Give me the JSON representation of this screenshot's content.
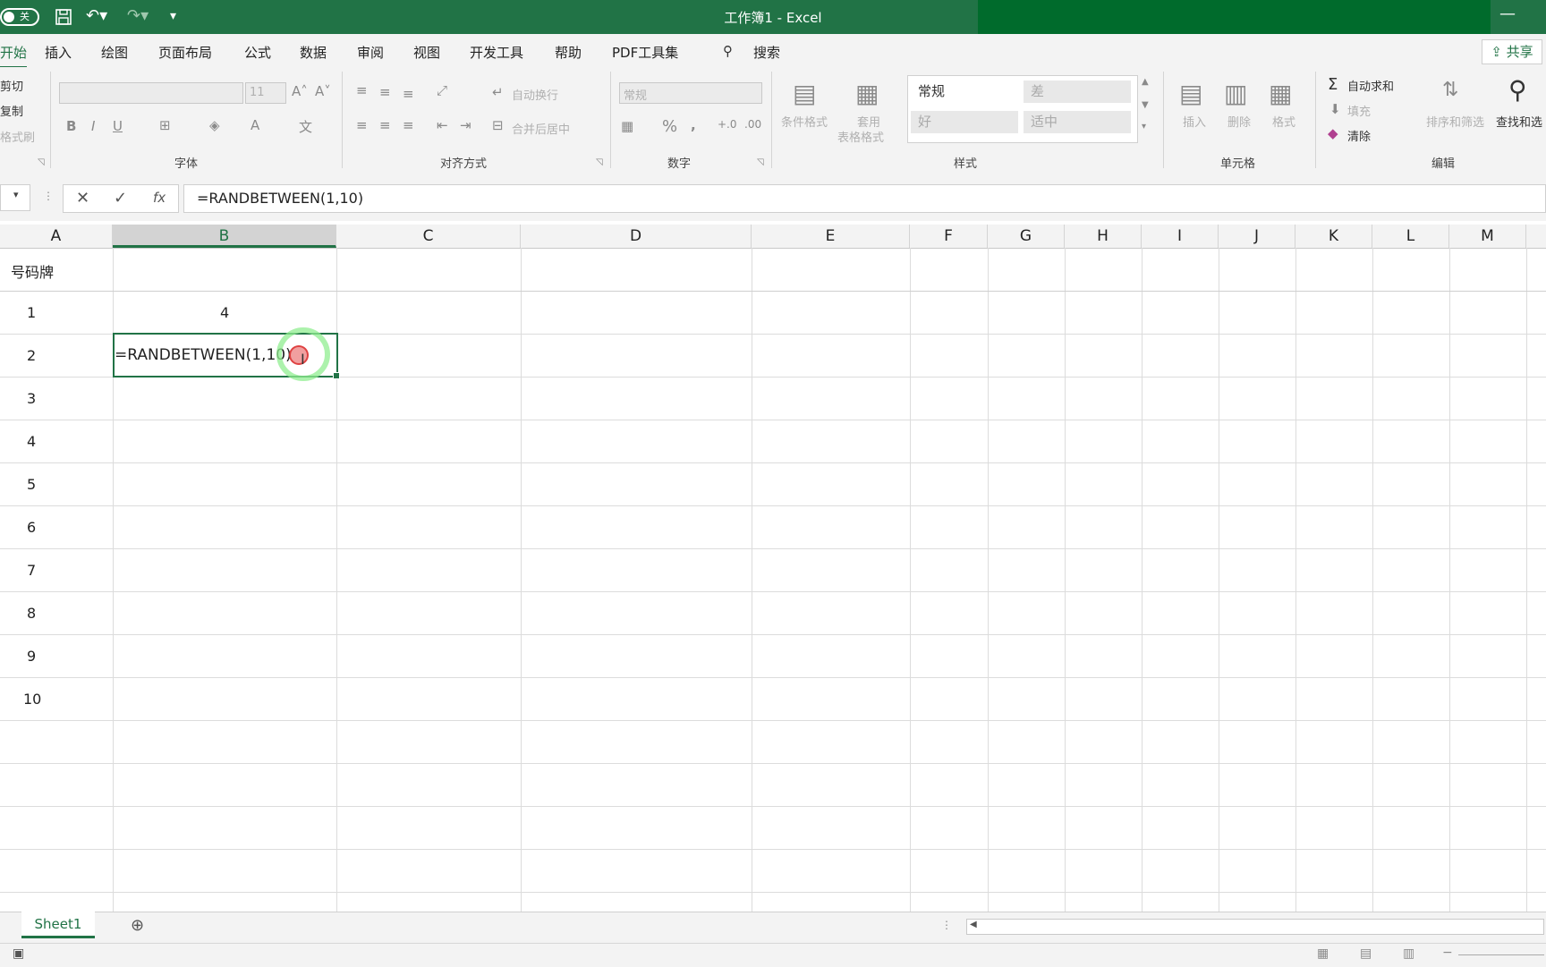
{
  "window": {
    "title": "工作簿1  -  Excel"
  },
  "quick_access": {
    "autosave_label": "关",
    "save_icon": "save-icon",
    "undo_icon": "undo-icon",
    "redo_icon": "redo-icon",
    "customize_icon": "customize-icon"
  },
  "tabs": [
    {
      "label": "开始"
    },
    {
      "label": "插入"
    },
    {
      "label": "绘图"
    },
    {
      "label": "页面布局"
    },
    {
      "label": "公式"
    },
    {
      "label": "数据"
    },
    {
      "label": "审阅"
    },
    {
      "label": "视图"
    },
    {
      "label": "开发工具"
    },
    {
      "label": "帮助"
    },
    {
      "label": "PDF工具集"
    }
  ],
  "search_label": "搜索",
  "share_label": "共享",
  "ribbon": {
    "clipboard": {
      "cut": "剪切",
      "copy": "复制",
      "format_painter": "格式刷"
    },
    "font": {
      "size": "11",
      "label": "字体"
    },
    "alignment": {
      "wrap": "自动换行",
      "merge": "合并后居中",
      "label": "对齐方式"
    },
    "number": {
      "format": "常规",
      "label": "数字"
    },
    "styles": {
      "cond_format": "条件格式",
      "table_format_1": "套用",
      "table_format_2": "表格格式",
      "normal": "常规",
      "bad": "差",
      "good": "好",
      "neutral": "适中",
      "label": "样式"
    },
    "cells": {
      "insert": "插入",
      "delete": "删除",
      "format": "格式",
      "label": "单元格"
    },
    "editing": {
      "autosum": "自动求和",
      "fill": "填充",
      "clear": "清除",
      "sort": "排序和筛选",
      "find": "查找和选",
      "label": "编辑"
    }
  },
  "formula_bar": {
    "value": "=RANDBETWEEN(1,10)",
    "fx": "fx"
  },
  "columns": [
    "A",
    "B",
    "C",
    "D",
    "E",
    "F",
    "G",
    "H",
    "I",
    "J",
    "K",
    "L",
    "M"
  ],
  "cells": {
    "A1": "号码牌",
    "A2": "1",
    "A3": "2",
    "A4": "3",
    "A5": "4",
    "A6": "5",
    "A7": "6",
    "A8": "7",
    "A9": "8",
    "A10": "9",
    "A11": "10",
    "B2": "4",
    "B3_editing": "=RANDBETWEEN(1,10)"
  },
  "sheets": [
    {
      "label": "Sheet1"
    }
  ]
}
